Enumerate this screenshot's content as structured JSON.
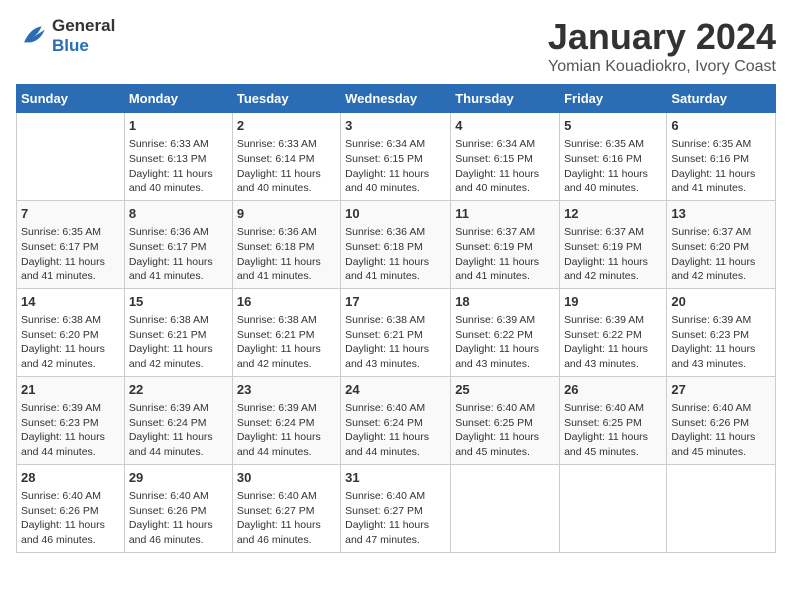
{
  "logo": {
    "line1": "General",
    "line2": "Blue"
  },
  "title": "January 2024",
  "subtitle": "Yomian Kouadiokro, Ivory Coast",
  "weekdays": [
    "Sunday",
    "Monday",
    "Tuesday",
    "Wednesday",
    "Thursday",
    "Friday",
    "Saturday"
  ],
  "weeks": [
    [
      {
        "day": "",
        "info": ""
      },
      {
        "day": "1",
        "info": "Sunrise: 6:33 AM\nSunset: 6:13 PM\nDaylight: 11 hours\nand 40 minutes."
      },
      {
        "day": "2",
        "info": "Sunrise: 6:33 AM\nSunset: 6:14 PM\nDaylight: 11 hours\nand 40 minutes."
      },
      {
        "day": "3",
        "info": "Sunrise: 6:34 AM\nSunset: 6:15 PM\nDaylight: 11 hours\nand 40 minutes."
      },
      {
        "day": "4",
        "info": "Sunrise: 6:34 AM\nSunset: 6:15 PM\nDaylight: 11 hours\nand 40 minutes."
      },
      {
        "day": "5",
        "info": "Sunrise: 6:35 AM\nSunset: 6:16 PM\nDaylight: 11 hours\nand 40 minutes."
      },
      {
        "day": "6",
        "info": "Sunrise: 6:35 AM\nSunset: 6:16 PM\nDaylight: 11 hours\nand 41 minutes."
      }
    ],
    [
      {
        "day": "7",
        "info": "Sunrise: 6:35 AM\nSunset: 6:17 PM\nDaylight: 11 hours\nand 41 minutes."
      },
      {
        "day": "8",
        "info": "Sunrise: 6:36 AM\nSunset: 6:17 PM\nDaylight: 11 hours\nand 41 minutes."
      },
      {
        "day": "9",
        "info": "Sunrise: 6:36 AM\nSunset: 6:18 PM\nDaylight: 11 hours\nand 41 minutes."
      },
      {
        "day": "10",
        "info": "Sunrise: 6:36 AM\nSunset: 6:18 PM\nDaylight: 11 hours\nand 41 minutes."
      },
      {
        "day": "11",
        "info": "Sunrise: 6:37 AM\nSunset: 6:19 PM\nDaylight: 11 hours\nand 41 minutes."
      },
      {
        "day": "12",
        "info": "Sunrise: 6:37 AM\nSunset: 6:19 PM\nDaylight: 11 hours\nand 42 minutes."
      },
      {
        "day": "13",
        "info": "Sunrise: 6:37 AM\nSunset: 6:20 PM\nDaylight: 11 hours\nand 42 minutes."
      }
    ],
    [
      {
        "day": "14",
        "info": "Sunrise: 6:38 AM\nSunset: 6:20 PM\nDaylight: 11 hours\nand 42 minutes."
      },
      {
        "day": "15",
        "info": "Sunrise: 6:38 AM\nSunset: 6:21 PM\nDaylight: 11 hours\nand 42 minutes."
      },
      {
        "day": "16",
        "info": "Sunrise: 6:38 AM\nSunset: 6:21 PM\nDaylight: 11 hours\nand 42 minutes."
      },
      {
        "day": "17",
        "info": "Sunrise: 6:38 AM\nSunset: 6:21 PM\nDaylight: 11 hours\nand 43 minutes."
      },
      {
        "day": "18",
        "info": "Sunrise: 6:39 AM\nSunset: 6:22 PM\nDaylight: 11 hours\nand 43 minutes."
      },
      {
        "day": "19",
        "info": "Sunrise: 6:39 AM\nSunset: 6:22 PM\nDaylight: 11 hours\nand 43 minutes."
      },
      {
        "day": "20",
        "info": "Sunrise: 6:39 AM\nSunset: 6:23 PM\nDaylight: 11 hours\nand 43 minutes."
      }
    ],
    [
      {
        "day": "21",
        "info": "Sunrise: 6:39 AM\nSunset: 6:23 PM\nDaylight: 11 hours\nand 44 minutes."
      },
      {
        "day": "22",
        "info": "Sunrise: 6:39 AM\nSunset: 6:24 PM\nDaylight: 11 hours\nand 44 minutes."
      },
      {
        "day": "23",
        "info": "Sunrise: 6:39 AM\nSunset: 6:24 PM\nDaylight: 11 hours\nand 44 minutes."
      },
      {
        "day": "24",
        "info": "Sunrise: 6:40 AM\nSunset: 6:24 PM\nDaylight: 11 hours\nand 44 minutes."
      },
      {
        "day": "25",
        "info": "Sunrise: 6:40 AM\nSunset: 6:25 PM\nDaylight: 11 hours\nand 45 minutes."
      },
      {
        "day": "26",
        "info": "Sunrise: 6:40 AM\nSunset: 6:25 PM\nDaylight: 11 hours\nand 45 minutes."
      },
      {
        "day": "27",
        "info": "Sunrise: 6:40 AM\nSunset: 6:26 PM\nDaylight: 11 hours\nand 45 minutes."
      }
    ],
    [
      {
        "day": "28",
        "info": "Sunrise: 6:40 AM\nSunset: 6:26 PM\nDaylight: 11 hours\nand 46 minutes."
      },
      {
        "day": "29",
        "info": "Sunrise: 6:40 AM\nSunset: 6:26 PM\nDaylight: 11 hours\nand 46 minutes."
      },
      {
        "day": "30",
        "info": "Sunrise: 6:40 AM\nSunset: 6:27 PM\nDaylight: 11 hours\nand 46 minutes."
      },
      {
        "day": "31",
        "info": "Sunrise: 6:40 AM\nSunset: 6:27 PM\nDaylight: 11 hours\nand 47 minutes."
      },
      {
        "day": "",
        "info": ""
      },
      {
        "day": "",
        "info": ""
      },
      {
        "day": "",
        "info": ""
      }
    ]
  ]
}
